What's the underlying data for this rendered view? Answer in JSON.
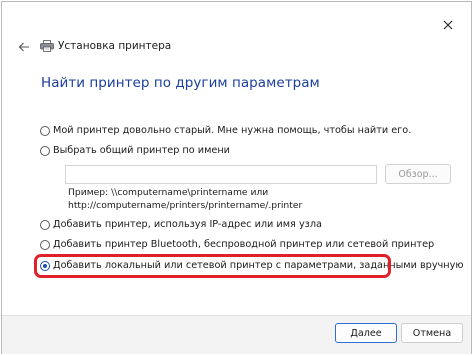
{
  "window": {
    "title": "Установка принтера",
    "close_icon": "close-icon",
    "back_icon": "back-arrow-icon",
    "app_icon": "printer-icon"
  },
  "heading": "Найти принтер по другим параметрам",
  "options": [
    {
      "label": "Мой принтер довольно старый. Мне нужна помощь, чтобы найти его.",
      "checked": false
    },
    {
      "label": "Выбрать общий принтер по имени",
      "checked": false
    },
    {
      "label": "Добавить принтер, используя IP-адрес или имя узла",
      "checked": false
    },
    {
      "label": "Добавить принтер Bluetooth, беспроводной принтер или сетевой принтер",
      "checked": false
    },
    {
      "label": "Добавить локальный или сетевой принтер с параметрами, заданными вручную",
      "checked": true
    }
  ],
  "shared_printer": {
    "input_value": "",
    "browse_label": "Обзор...",
    "example_line1": "Пример: \\\\computername\\printername или",
    "example_line2": "http://computername/printers/printername/.printer"
  },
  "footer": {
    "next_label": "Далее",
    "cancel_label": "Отмена"
  },
  "colors": {
    "heading": "#1c3f9c",
    "accent": "#1a4fb4",
    "highlight": "#e0202a"
  }
}
